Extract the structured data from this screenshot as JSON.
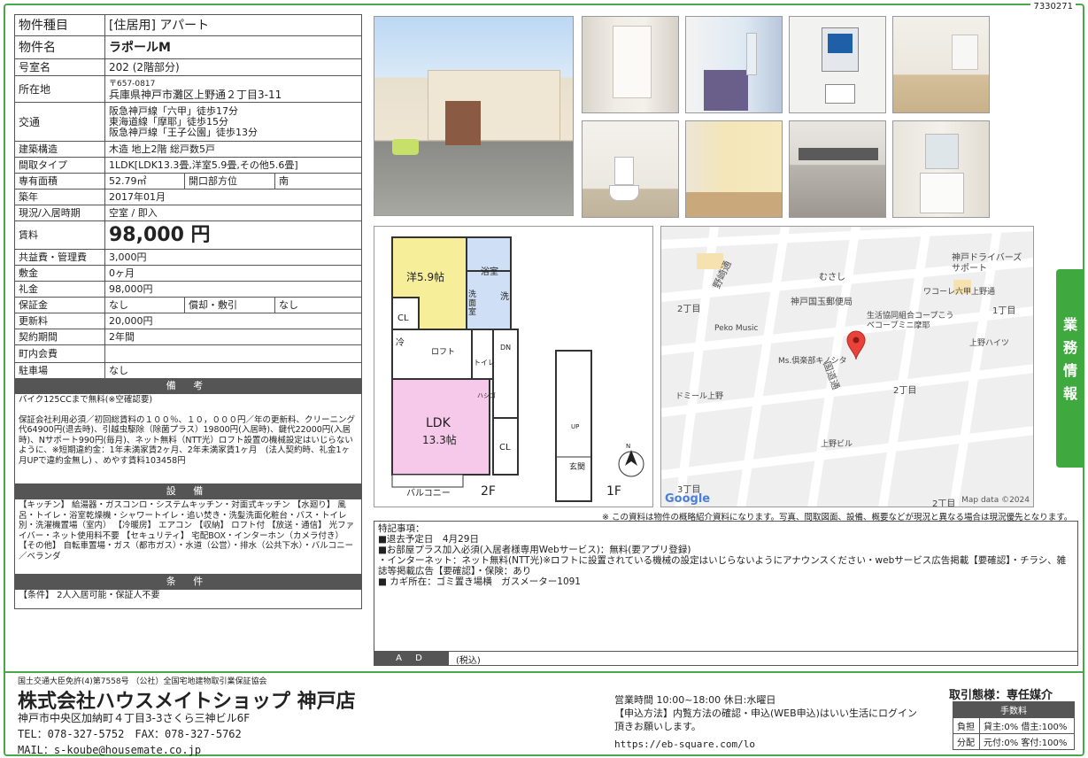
{
  "doc_id": "7330271",
  "spec": {
    "type_k": "物件種目",
    "type_v": "[住居用] アパート",
    "name_k": "物件名",
    "name_v": "ラポールM",
    "room_k": "号室名",
    "room_v": "202 (2階部分)",
    "addr_k": "所在地",
    "zip": "〒657-0817",
    "addr_v": "兵庫県神戸市灘区上野通２丁目3-11",
    "traffic_k": "交通",
    "traffic_lines": [
      "阪急神戸線「六甲」徒歩17分",
      "東海道線「摩耶」徒歩15分",
      "阪急神戸線「王子公園」徒歩13分"
    ],
    "struct_k": "建築構造",
    "struct_v": "木造 地上2階 総戸数5戸",
    "layout_k": "間取タイプ",
    "layout_v": "1LDK[LDK13.3畳,洋室5.9畳,その他5.6畳]",
    "area_k": "専有面積",
    "area_v": "52.79㎡",
    "dir_k": "開口部方位",
    "dir_v": "南",
    "built_k": "築年",
    "built_v": "2017年01月",
    "status_k": "現況/入居時期",
    "status_v": "空室 / 即入",
    "rent_k": "賃料",
    "rent_v": "98,000 円",
    "mgmt_k": "共益費・管理費",
    "mgmt_v": "3,000円",
    "deposit_k": "敷金",
    "deposit_v": "0ヶ月",
    "key_k": "礼金",
    "key_v": "98,000円",
    "guar_k": "保証金",
    "guar_v": "なし",
    "amort_k": "償却・敷引",
    "amort_v": "なし",
    "renew_k": "更新料",
    "renew_v": "20,000円",
    "term_k": "契約期間",
    "term_v": "2年間",
    "assoc_k": "町内会費",
    "assoc_v": "",
    "parking_k": "駐車場",
    "parking_v": "なし"
  },
  "bikou": {
    "title": "備 考",
    "lines": [
      "バイク125CCまで無料(※空確認要)",
      "",
      "保証会社利用必須／初回総賃料の１００％、１０，０００円／年の更新料、クリーニング代64900円(退去時)、引越虫駆除（除菌プラス）19800円(入居時)、鍵代22000円(入居時)、Nサポート990円(毎月)、ネット無料（NTT光）ロフト設置の機械設定はいじらないように、※短期違約金：1年未満家賃2ヶ月、2年未満家賃1ヶ月　(法人契約時、礼金1ヶ月UPで違約金無し) 、めやす賃料103458円"
    ]
  },
  "setsubi": {
    "title": "設 備",
    "text": "【キッチン】 給湯器・ガスコンロ・システムキッチン・対面式キッチン 【水廻り】 風呂・トイレ・浴室乾燥機・シャワートイレ・追い焚き・洗髪洗面化粧台・バス・トイレ別・洗濯機置場（室内） 【冷暖房】 エアコン 【収納】 ロフト付 【放送・通信】 光ファイバー・ネット使用料不要 【セキュリティ】 宅配BOX・インターホン（カメラ付き） 【その他】 自転車置場・ガス（都市ガス）・水道（公営）・排水（公共下水）・バルコニー／ベランダ"
  },
  "jouken": {
    "title": "条 件",
    "text": "【条件】 2人入居可能・保証人不要"
  },
  "floor": {
    "youshitsu": "洋5.9帖",
    "yokushitsu": "浴室",
    "senmen": "洗面室",
    "arai": "洗",
    "cl1": "CL",
    "rei": "冷",
    "loft": "ロフト",
    "toilet": "トイレ",
    "dn": "DN",
    "ldk": "LDK",
    "ldk_size": "13.3帖",
    "cl2": "CL",
    "balcony": "バルコニー",
    "f2": "2F",
    "f1": "1F",
    "up": "UP",
    "genkan": "玄関",
    "hashigo": "ハシゴ"
  },
  "map": {
    "labels": [
      "神戸ドライバーズサポート",
      "むさし",
      "神戸国玉郵便局",
      "ワコーレ六甲上野通",
      "生活協同組合コープこうべコープミニ摩耶",
      "Peko Music",
      "Ms.倶楽部キノシタ",
      "上野ハイツ",
      "ドミール上野",
      "上野ビル",
      "野崎通",
      "国道通",
      "2丁目",
      "1丁目",
      "2丁目",
      "3丁目",
      "2丁目"
    ],
    "google": "Google",
    "credit": "Map data ©2024"
  },
  "side_tab": "業務情報",
  "disclaimer": "※ この資料は物件の概略紹介資料になります。写真、間取図面、設備、概要などが現況と異なる場合は現況優先となります。",
  "remarks": {
    "lines": [
      "特記事項：",
      "■退去予定日　4月29日",
      "■お部屋プラス加入必須(入居者様専用Webサービス)：無料(要アプリ登録)",
      "・インターネット：ネット無料(NTT光)※ロフトに設置されている機械の設定はいじらないようにアナウンスください・webサービス広告掲載【要確認】・チラシ、雑誌等掲載広告【要確認】・保険：あり",
      "■ カギ所在：ゴミ置き場横　ガスメーター1091"
    ],
    "ad_label": "A D",
    "ad_value": "(税込)"
  },
  "footer": {
    "license": "国土交通大臣免許(4)第7558号 （公社）全国宅地建物取引業保証協会",
    "company": "株式会社ハウスメイトショップ 神戸店",
    "address": "神戸市中央区加納町４丁目3-3さくら三神ビル6F",
    "tel": "TEL：078-327-5752　FAX：078-327-5762",
    "mail": "MAIL：s-koube@housemate.co.jp",
    "hours": "営業時間 10:00~18:00 休日:水曜日",
    "apply": "【申込方法】内覧方法の確認・申込(WEB申込)はいい生活にログイン頂きお願いします。",
    "url": "https://eb-square.com/lo",
    "torihiki": "取引態様：専任媒介",
    "fee_title": "手数料",
    "fee_r1_k": "負担",
    "fee_r1_v": "貸主:0% 借主:100%",
    "fee_r2_k": "分配",
    "fee_r2_v": "元付:0% 客付:100%"
  }
}
